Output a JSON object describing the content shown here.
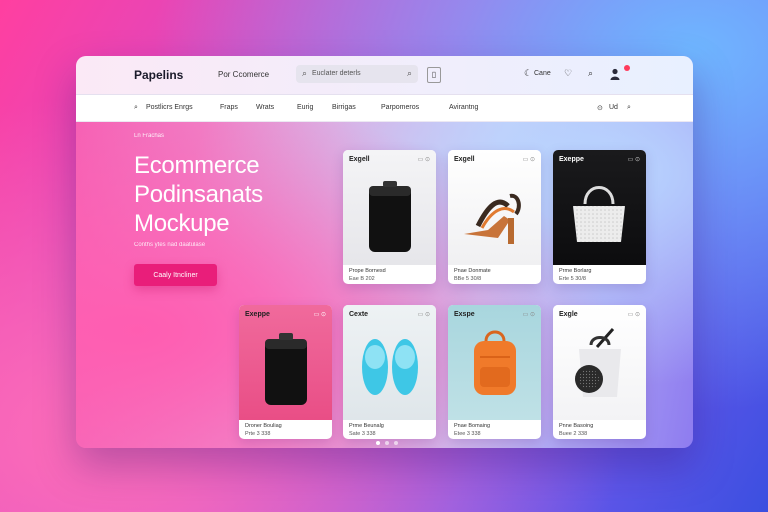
{
  "header": {
    "brand": "Papelins",
    "nav_label": "Por Ccomerce",
    "search_placeholder": "Euclater deterls",
    "cart_label": "Cane"
  },
  "categories": [
    "Postlicrs Enrgs",
    "Fraps",
    "Wrats",
    "Eurig",
    "Birrigas",
    "Parpomeros",
    "Avirantng"
  ],
  "hero": {
    "kicker": "Ln Frachas",
    "title_lines": [
      "Ecommerce",
      "Podinsanats",
      "Mockupe"
    ],
    "subtitle": "Conths ytes nad daatulase",
    "cta_label": "Caaly Itncliner"
  },
  "products": [
    {
      "title": "Exgell",
      "icons": "▭ ⊙",
      "name": "Prope Bornesd",
      "price": "Eae B 202"
    },
    {
      "title": "Exgell",
      "icons": "▭ ⊙",
      "name": "Pnae Donmate",
      "price": "BBe 5 30/8"
    },
    {
      "title": "Exeppe",
      "icons": "▭ ⊙",
      "name": "Prme Borlarg",
      "price": "Erte 5 30/8"
    },
    {
      "title": "Exeppe",
      "icons": "▭ ⊙",
      "name": "Droner Bouliag",
      "price": "Prte 3 338"
    },
    {
      "title": "Cexte",
      "icons": "▭ ⊙",
      "name": "Prme Beunalg",
      "price": "Sate 3 338"
    },
    {
      "title": "Exspe",
      "icons": "▭ ⊙",
      "name": "Pnae Bomaing",
      "price": "Etee 3 338"
    },
    {
      "title": "Exgle",
      "icons": "▭ ⊙",
      "name": "Pnne Basoing",
      "price": "Buee 2 338"
    }
  ]
}
